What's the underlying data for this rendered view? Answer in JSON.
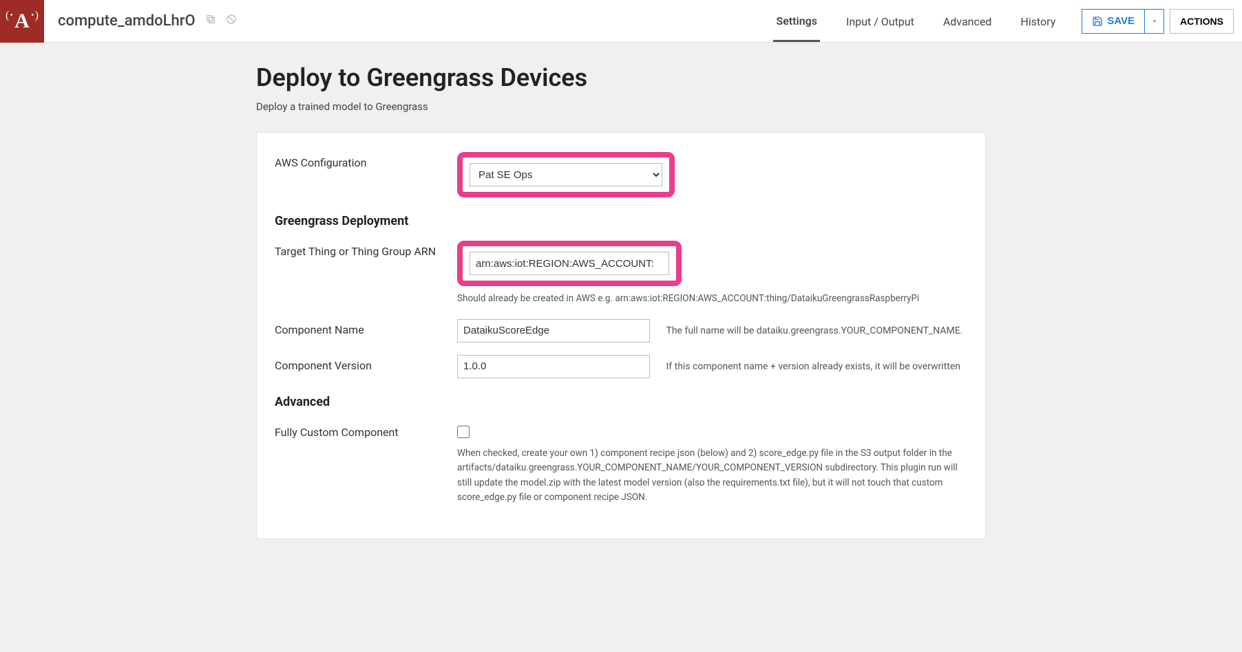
{
  "header": {
    "compute_name": "compute_amdoLhrO",
    "tabs": [
      "Settings",
      "Input / Output",
      "Advanced",
      "History"
    ],
    "active_tab": 0,
    "save_label": "SAVE",
    "actions_label": "ACTIONS"
  },
  "page": {
    "title": "Deploy to Greengrass Devices",
    "subtitle": "Deploy a trained model to Greengrass"
  },
  "form": {
    "aws_config_label": "AWS Configuration",
    "aws_config_value": "Pat SE Ops",
    "section_deployment": "Greengrass Deployment",
    "target_arn_label": "Target Thing or Thing Group ARN",
    "target_arn_value": "arn:aws:iot:REGION:AWS_ACCOUNT:",
    "target_arn_hint": "Should already be created in AWS e.g. arn:aws:iot:REGION:AWS_ACCOUNT:thing/DataikuGreengrassRaspberryPi",
    "component_name_label": "Component Name",
    "component_name_value": "DataikuScoreEdge",
    "component_name_hint": "The full name will be dataiku.greengrass.YOUR_COMPONENT_NAME.",
    "component_version_label": "Component Version",
    "component_version_value": "1.0.0",
    "component_version_hint": "If this component name + version already exists, it will be overwritten",
    "section_advanced": "Advanced",
    "fully_custom_label": "Fully Custom Component",
    "fully_custom_checked": false,
    "fully_custom_hint": "When checked, create your own 1) component recipe json (below) and 2) score_edge.py file in the S3 output folder in the artifacts/dataiku.greengrass.YOUR_COMPONENT_NAME/YOUR_COMPONENT_VERSION subdirectory. This plugin run will still update the model.zip with the latest model version (also the requirements.txt file), but it will not touch that custom score_edge.py file or component recipe JSON."
  }
}
